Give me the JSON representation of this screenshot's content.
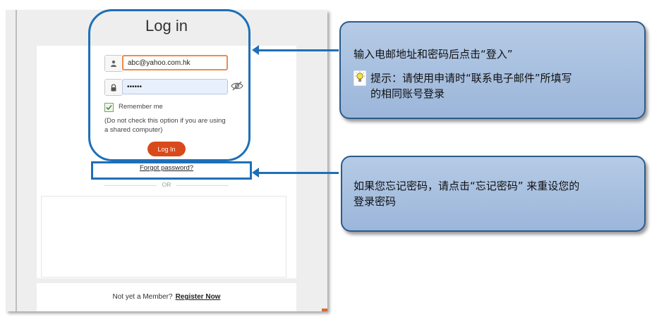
{
  "login": {
    "title": "Log in",
    "email_value": "abc@yahoo.com.hk",
    "password_value": "••••••",
    "remember_label": "Remember me",
    "remember_checked": true,
    "hint_line1": "(Do not check this option if you are using",
    "hint_line2": "a shared computer)",
    "login_button": "Log In",
    "forgot_link": "Forgot password?",
    "or_label": "OR",
    "not_member": "Not yet a Member?",
    "register_link": "Register Now"
  },
  "callouts": {
    "top": {
      "line1": "输入电邮地址和密码后点击“登入”",
      "tip_line1": "提示：请使用申请时“联系电子邮件”所填写",
      "tip_line2": "的相同账号登录"
    },
    "bottom": {
      "line1": "如果您忘记密码，请点击“忘记密码” 来重设您的",
      "line2": "登录密码"
    }
  },
  "icons": {
    "email": "user-icon",
    "password": "lock-icon",
    "show_password": "eye-slash-icon",
    "checkbox": "check-icon",
    "tip": "lightbulb-icon"
  },
  "colors": {
    "highlight": "#1e6fb8",
    "login_button": "#d84a1b",
    "callout_fill": "#a9c1e0",
    "email_focus": "#f08a4b"
  }
}
